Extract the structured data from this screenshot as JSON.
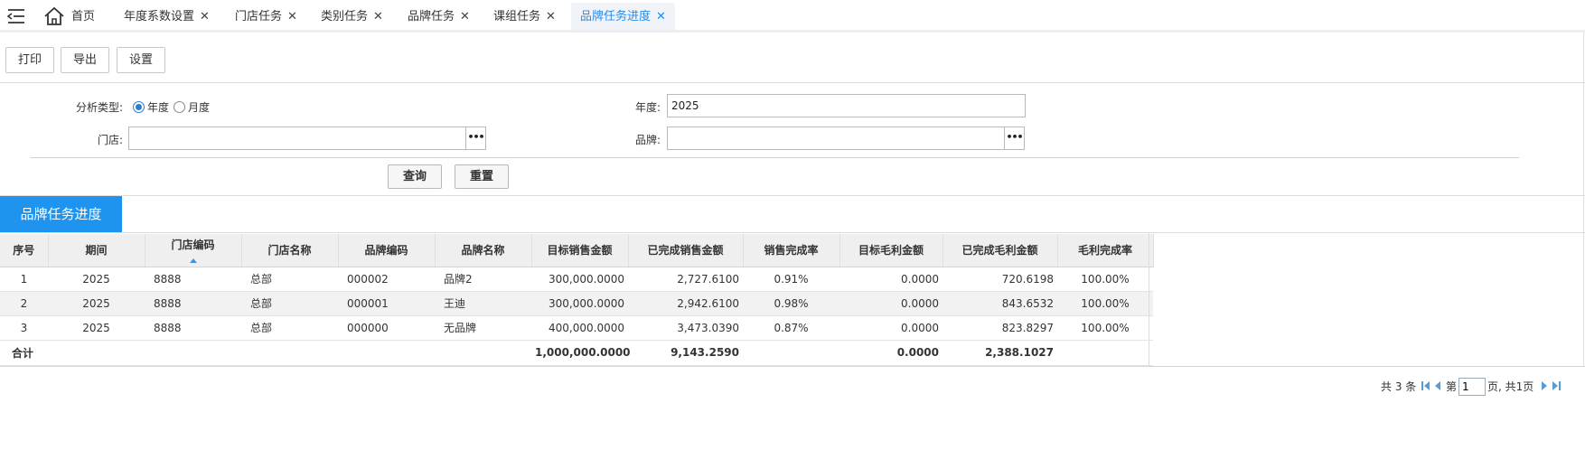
{
  "tabs": {
    "home": "首页",
    "items": [
      "年度系数设置",
      "门店任务",
      "类别任务",
      "品牌任务",
      "课组任务"
    ],
    "active": "品牌任务进度",
    "close_glyph": "✕"
  },
  "toolbar": {
    "print": "打印",
    "export": "导出",
    "settings": "设置"
  },
  "form": {
    "analysis_type_label": "分析类型:",
    "radio_year": "年度",
    "radio_month": "月度",
    "year_label": "年度:",
    "year_value": "2025",
    "store_label": "门店:",
    "store_value": "",
    "brand_label": "品牌:",
    "brand_value": "",
    "query": "查询",
    "reset": "重置",
    "selected_analysis": "年度"
  },
  "section_title": "品牌任务进度",
  "grid": {
    "headers": [
      "序号",
      "期间",
      "门店编码",
      "门店名称",
      "品牌编码",
      "品牌名称",
      "目标销售金额",
      "已完成销售金额",
      "销售完成率",
      "目标毛利金额",
      "已完成毛利金额",
      "毛利完成率"
    ],
    "rows": [
      [
        "1",
        "2025",
        "8888",
        "总部",
        "000002",
        "品牌2",
        "300,000.0000",
        "2,727.6100",
        "0.91%",
        "0.0000",
        "720.6198",
        "100.00%"
      ],
      [
        "2",
        "2025",
        "8888",
        "总部",
        "000001",
        "王迪",
        "300,000.0000",
        "2,942.6100",
        "0.98%",
        "0.0000",
        "843.6532",
        "100.00%"
      ],
      [
        "3",
        "2025",
        "8888",
        "总部",
        "000000",
        "无品牌",
        "400,000.0000",
        "3,473.0390",
        "0.87%",
        "0.0000",
        "823.8297",
        "100.00%"
      ]
    ],
    "total": {
      "label": "合计",
      "target_sales": "1,000,000.0000",
      "done_sales": "9,143.2590",
      "target_profit": "0.0000",
      "done_profit": "2,388.1027"
    }
  },
  "pager": {
    "total_text": "共 3 条",
    "page_prefix": "第",
    "page_value": "1",
    "page_suffix": "页, 共1页"
  },
  "colors": {
    "accent": "#1e94ef",
    "active_tab_text": "#2a8be6"
  }
}
